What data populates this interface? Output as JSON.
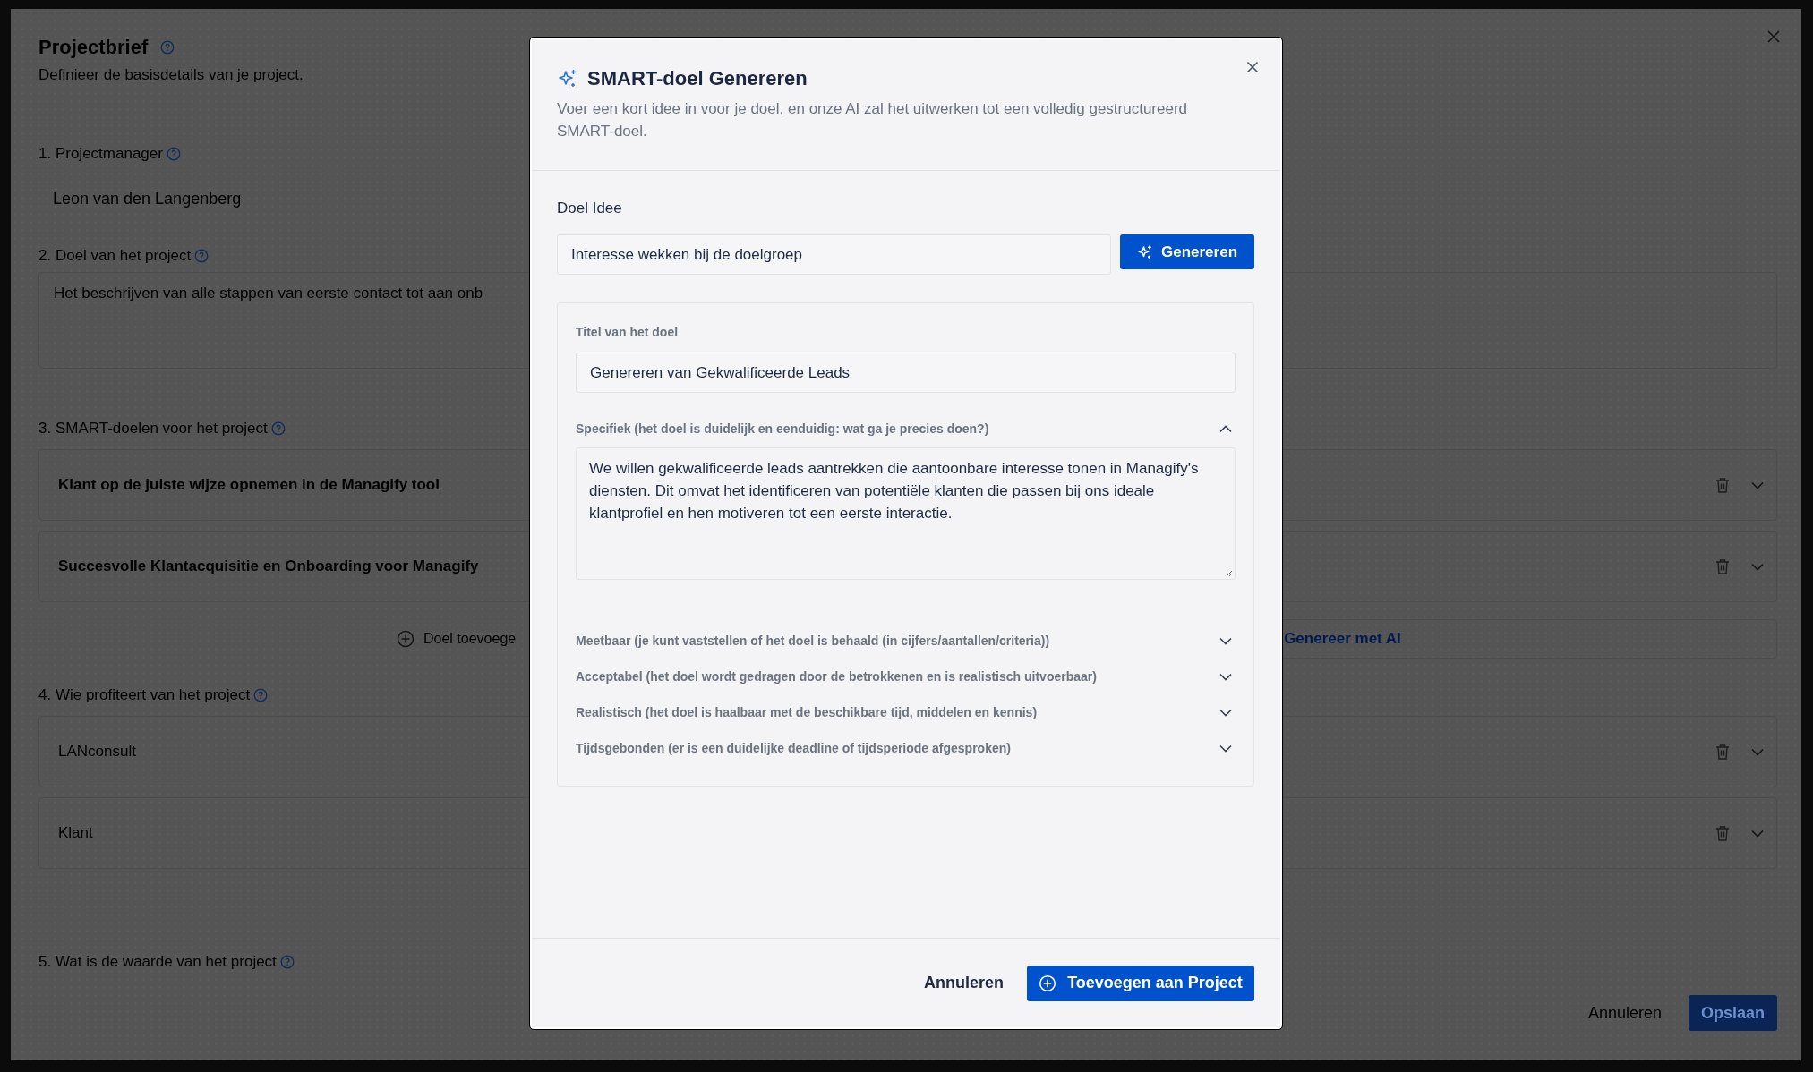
{
  "page": {
    "title": "Projectbrief",
    "subtitle": "Definieer de basisdetails van je project.",
    "sections": [
      {
        "kind": "value",
        "label": "1. Projectmanager",
        "value": "Leon van den Langenberg"
      },
      {
        "kind": "textarea",
        "label": "2. Doel van het project",
        "value": "Het beschrijven van alle stappen van eerste contact tot aan onb"
      },
      {
        "kind": "list",
        "label": "3. SMART-doelen voor het project",
        "items": [
          "Klant op de juiste wijze opnemen in de Managify tool",
          "Succesvolle Klantacquisitie en Onboarding voor Managify"
        ],
        "add_button": "Doel toevoege",
        "ai_button": "Genereer met AI"
      },
      {
        "kind": "list",
        "label": "4. Wie profiteert van het project",
        "items": [
          "LANconsult",
          "Klant"
        ]
      },
      {
        "kind": "heading",
        "label": "5. Wat is de waarde van het project"
      }
    ],
    "cancel_button": "Annuleren",
    "save_button": "Opslaan"
  },
  "modal": {
    "title": "SMART-doel Genereren",
    "description": "Voer een kort idee in voor je doel, en onze AI zal het uitwerken tot een volledig gestructureerd SMART-doel.",
    "idea_label": "Doel Idee",
    "idea_value": "Interesse wekken bij de doelgroep",
    "generate_button": "Genereren",
    "title_label": "Titel van het doel",
    "title_value": "Genereren van Gekwalificeerde Leads",
    "criteria": [
      {
        "label": "Specifiek (het doel is duidelijk en eenduidig: wat ga je precies doen?)",
        "expanded": true,
        "value": "We willen gekwalificeerde leads aantrekken die aantoonbare interesse tonen in Managify's diensten. Dit omvat het identificeren van potentiële klanten die passen bij ons ideale klantprofiel en hen motiveren tot een eerste interactie."
      },
      {
        "label": "Meetbaar (je kunt vaststellen of het doel is behaald (in cijfers/aantallen/criteria))",
        "expanded": false
      },
      {
        "label": "Acceptabel (het doel wordt gedragen door de betrokkenen en is realistisch uitvoerbaar)",
        "expanded": false
      },
      {
        "label": "Realistisch (het doel is haalbaar met de beschikbare tijd, middelen en kennis)",
        "expanded": false
      },
      {
        "label": "Tijdsgebonden (er is een duidelijke deadline of tijdsperiode afgesproken)",
        "expanded": false
      }
    ],
    "cancel_button": "Annuleren",
    "submit_button": "Toevoegen aan Project"
  }
}
